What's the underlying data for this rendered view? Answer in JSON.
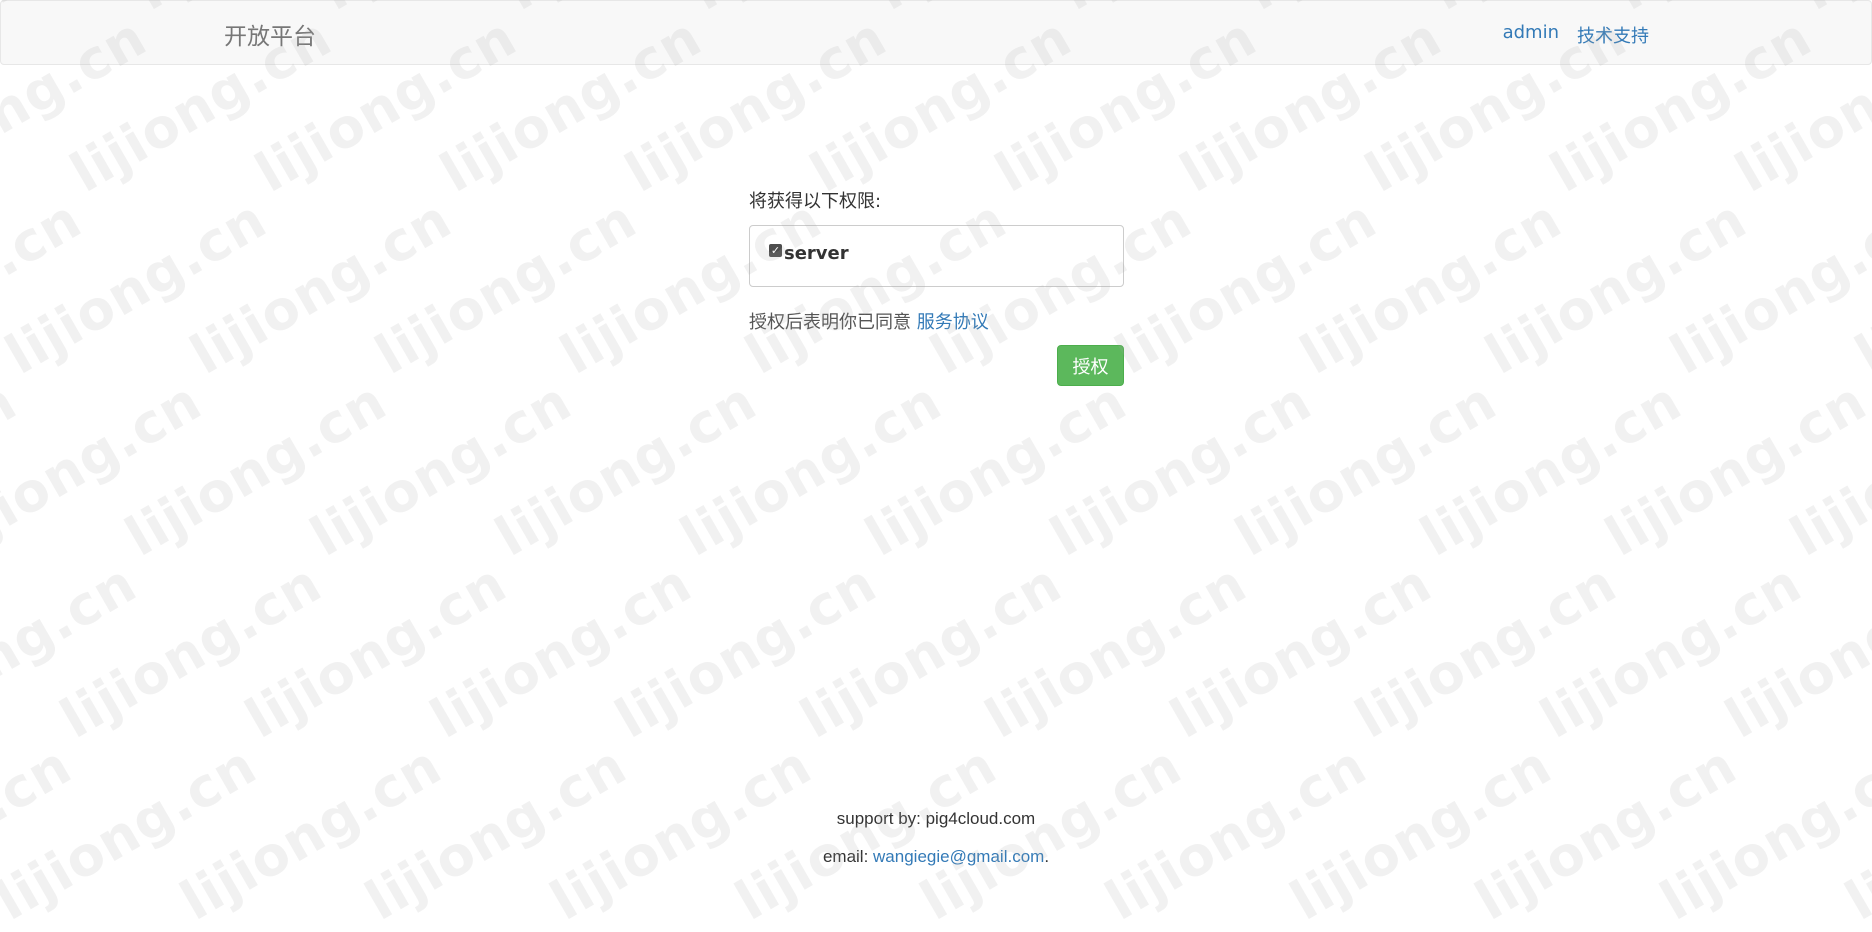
{
  "navbar": {
    "brand": "开放平台",
    "links": [
      "admin",
      "技术支持"
    ]
  },
  "authorize": {
    "permission_label": "将获得以下权限:",
    "scopes": [
      {
        "name": "server",
        "checked": true
      }
    ],
    "agree_text": "授权后表明你已同意 ",
    "agreement_link": "服务协议",
    "button_label": "授权"
  },
  "footer": {
    "support_text": "support by: pig4cloud.com",
    "email_prefix": "email: ",
    "email": "wangiegie@gmail.com",
    "email_suffix": "."
  },
  "watermark": {
    "text": "lijiong.cn"
  },
  "colors": {
    "link": "#337ab7",
    "success": "#5cb85c",
    "navbar_bg": "#f8f8f8"
  }
}
